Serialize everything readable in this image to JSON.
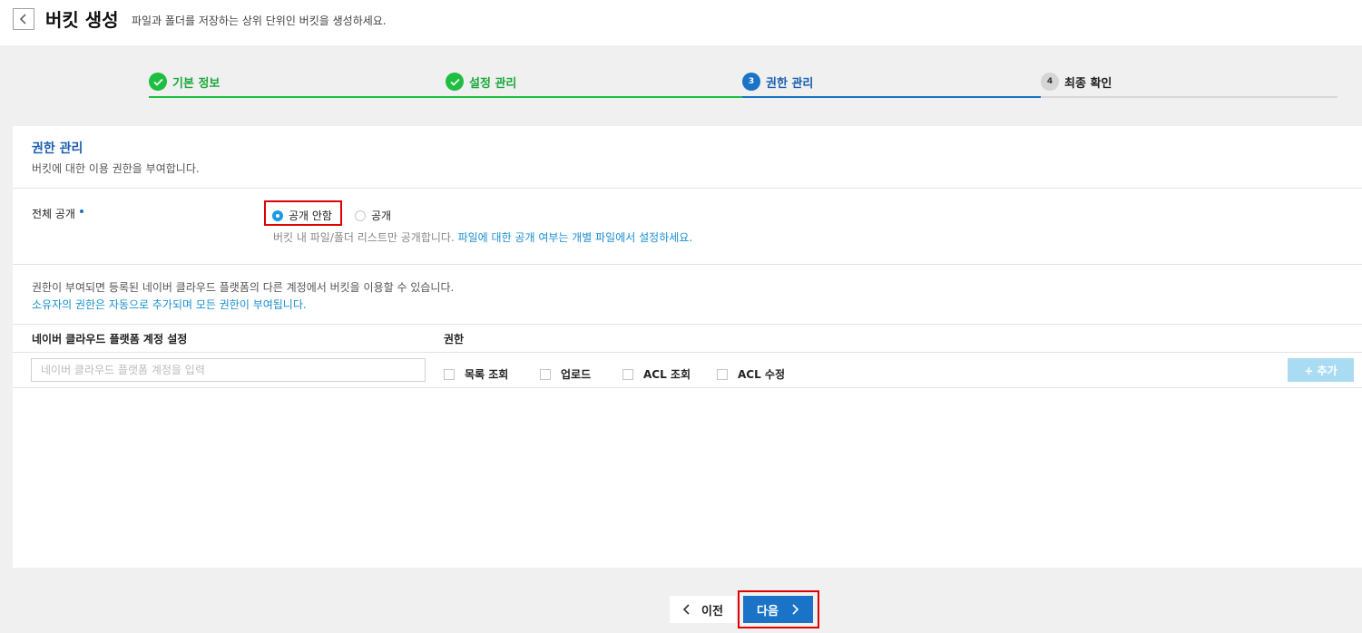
{
  "header": {
    "title": "버킷 생성",
    "description": "파일과 폴더를 저장하는 상위 단위인 버킷을 생성하세요."
  },
  "stepper": {
    "steps": [
      {
        "number": "1",
        "label": "기본 정보",
        "status": "done"
      },
      {
        "number": "2",
        "label": "설정 관리",
        "status": "done"
      },
      {
        "number": "3",
        "label": "권한 관리",
        "status": "active"
      },
      {
        "number": "4",
        "label": "최종 확인",
        "status": "pending"
      }
    ]
  },
  "permission": {
    "title": "권한 관리",
    "description": "버킷에 대한 이용 권한을 부여합니다.",
    "public_access": {
      "label": "전체 공개",
      "options": [
        {
          "label": "공개 안함",
          "selected": true
        },
        {
          "label": "공개",
          "selected": false
        }
      ],
      "help_text": "버킷 내 파일/폴더 리스트만 공개합니다.",
      "help_link": "파일에 대한 공개 여부는 개별 파일에서 설정하세요."
    },
    "info_text": "권한이 부여되면 등록된 네이버 클라우드 플랫폼의 다른 계정에서 버킷을 이용할 수 있습니다.",
    "info_note": "소유자의 권한은 자동으로 추가되며 모든 권한이 부여됩니다.",
    "account_column": "네이버 클라우드 플랫폼 계정 설정",
    "permission_column": "권한",
    "account_input": {
      "value": "",
      "placeholder": "네이버 클라우드 플랫폼 계정을 입력"
    },
    "checkboxes": [
      {
        "label": "목록 조회",
        "checked": false
      },
      {
        "label": "업로드",
        "checked": false
      },
      {
        "label": "ACL 조회",
        "checked": false
      },
      {
        "label": "ACL 수정",
        "checked": false
      }
    ],
    "add_label": "+ 추가"
  },
  "footer": {
    "prev_label": "이전",
    "next_label": "다음"
  },
  "colors": {
    "done": "#1fbe42",
    "active": "#1a73c7",
    "link": "#1a8fd0",
    "highlight": "#e00000",
    "add_button": "#a9dcf3"
  }
}
